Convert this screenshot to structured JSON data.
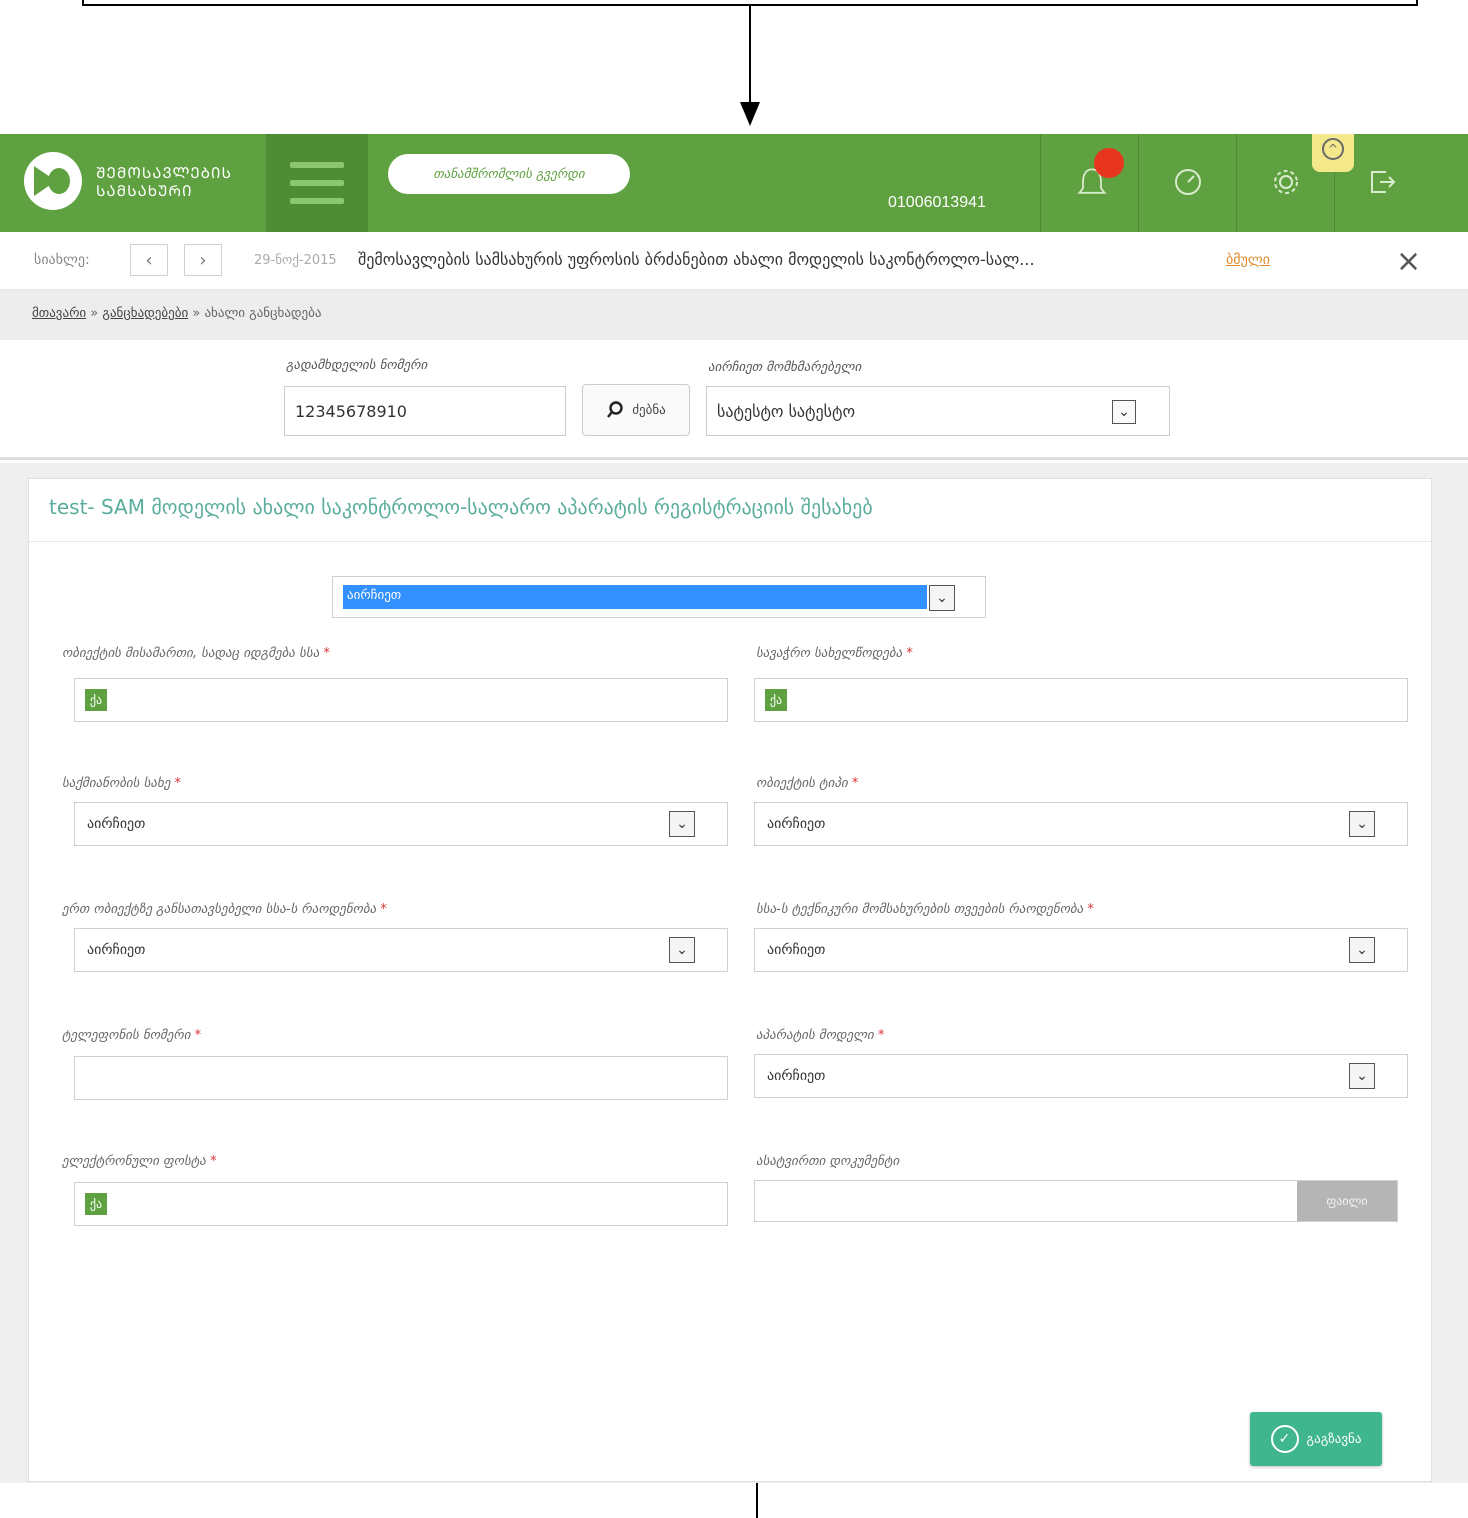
{
  "header": {
    "logo_title": "ᲨᲔᲛᲝᲡᲐᲕᲚᲔᲑᲘᲡ ᲡᲐᲛᲡᲐᲮᲣᲠᲘ",
    "pill_label": "თანამშრომლის გვერდი",
    "user_id": "01006013941",
    "icons": [
      "menu-icon",
      "bell-icon",
      "dashboard-icon",
      "gear-icon",
      "logout-icon",
      "collapse-icon"
    ],
    "colors": {
      "brand": "#5fa040",
      "brand_dark": "#4f8d34",
      "alert": "#e8351d",
      "accent": "#3fb68e"
    }
  },
  "news": {
    "label": "სიახლე:",
    "prev": "‹",
    "next": "›",
    "date": "29-ნოქ-2015",
    "text": "შემოსავლების სამსახურის უფროსის ბრძანებით ახალი მოდელის საკონტროლო-სალ...",
    "more": "ბმული",
    "close": "×"
  },
  "breadcrumb": {
    "items": [
      "მთავარი",
      "განცხადებები",
      "ახალი განცხადება"
    ],
    "separator": "»"
  },
  "search": {
    "id_label": "გადამხდელის ნომერი",
    "id_value": "12345678910",
    "search_button": "ძებნა",
    "user_label": "აირჩიეთ მომხმარებელი",
    "user_value": "სატესტო სატესტო"
  },
  "form": {
    "title": "test- SAM მოდელის ახალი საკონტროლო-სალარო აპარატის რეგისტრაციის შესახებ",
    "top_select": "აირჩიეთ",
    "kbd_label": "ქა",
    "fields": [
      {
        "label": "ობიექტის მისამართი, სადაც იდგმება სსა",
        "value": ""
      },
      {
        "label": "სავაჭრო სახელწოდება",
        "value": ""
      },
      {
        "label": "საქმიანობის სახე",
        "value": "აირჩიეთ"
      },
      {
        "label": "ობიექტის ტიპი",
        "value": "აირჩიეთ"
      },
      {
        "label": "ერთ ობიექტზე განსათავსებელი სსა-ს რაოდენობა",
        "value": "აირჩიეთ"
      },
      {
        "label": "სსა-ს ტექნიკური მომსახურების თვეების რაოდენობა",
        "value": "აირჩიეთ"
      },
      {
        "label": "ტელეფონის ნომერი",
        "value": ""
      },
      {
        "label": "აპარატის მოდელი",
        "value": "აირჩიეთ"
      },
      {
        "label": "ელექტრონული ფოსტა",
        "value": ""
      },
      {
        "label": "ასატვირთი დოკუმენტი",
        "value": ""
      }
    ],
    "required_mark": "*",
    "browse_button": "ფაილი",
    "save_button": "გაგზავნა"
  }
}
